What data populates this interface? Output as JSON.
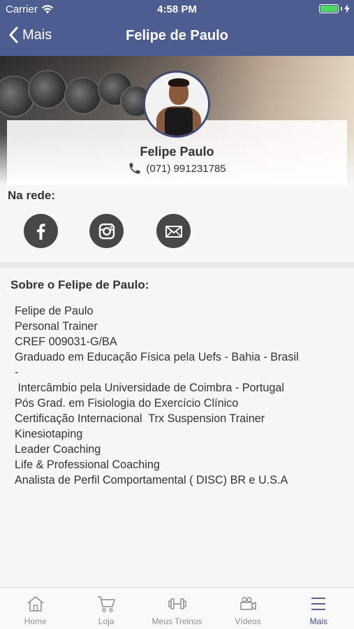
{
  "status": {
    "carrier": "Carrier",
    "time": "4:58 PM"
  },
  "nav": {
    "back_label": "Mais",
    "title": "Felipe de Paulo"
  },
  "profile": {
    "name": "Felipe Paulo",
    "phone": "(071) 991231785"
  },
  "social": {
    "label": "Na rede:",
    "networks": [
      "facebook-icon",
      "instagram-icon",
      "mail-icon"
    ]
  },
  "about": {
    "title": "Sobre o Felipe de Paulo:",
    "lines": [
      "Felipe de Paulo",
      "Personal Trainer",
      "CREF 009031-G/BA",
      "Graduado em Educação Física pela Uefs - Bahia - Brasil",
      "-",
      " Intercâmbio pela Universidade de Coimbra - Portugal",
      "Pós Grad. em Fisiologia do Exercício Clínico",
      "Certificação Internacional  Trx Suspension Trainer",
      "Kinesiotaping",
      "Leader Coaching",
      "Life & Professional Coaching",
      "Analista de Perfil Comportamental ( DISC) BR e U.S.A"
    ]
  },
  "tabs": [
    {
      "label": "Home",
      "icon": "home-icon"
    },
    {
      "label": "Loja",
      "icon": "cart-icon"
    },
    {
      "label": "Meus Treinos",
      "icon": "dumbbell-icon"
    },
    {
      "label": "Vídeos",
      "icon": "video-camera-icon"
    },
    {
      "label": "Mais",
      "icon": "menu-icon",
      "active": true
    }
  ],
  "colors": {
    "nav_bg": "#4d5d8f",
    "accent": "#3e4f86",
    "social_bg": "#474747",
    "battery": "#4cd964"
  }
}
